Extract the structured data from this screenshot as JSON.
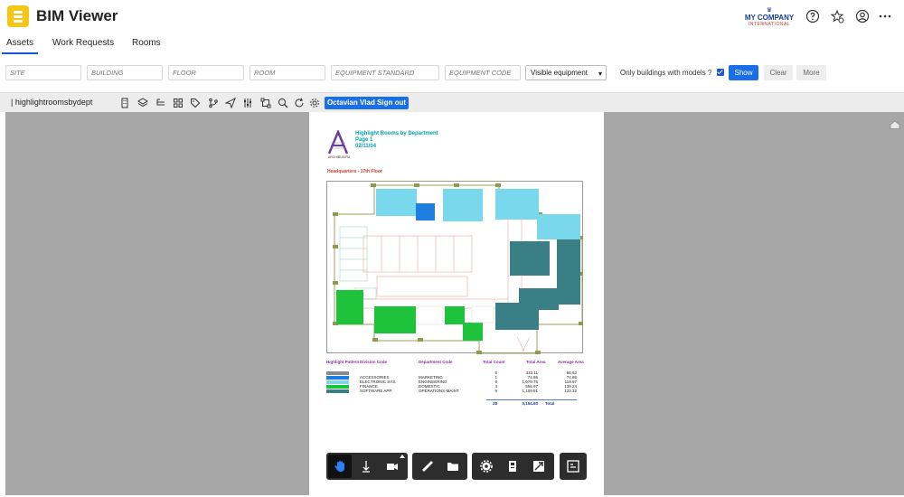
{
  "app": {
    "title": "BIM Viewer"
  },
  "brand": {
    "name": "MY COMPANY",
    "tagline": "INTERNATIONAL"
  },
  "header_icons": [
    "help-icon",
    "favorite-star-icon",
    "user-icon",
    "more-horizontal-icon"
  ],
  "tabs": [
    {
      "label": "Assets",
      "active": true
    },
    {
      "label": "Work Requests",
      "active": false
    },
    {
      "label": "Rooms",
      "active": false
    }
  ],
  "filters": {
    "site": {
      "placeholder": "SITE",
      "value": ""
    },
    "building": {
      "placeholder": "BUILDING",
      "value": ""
    },
    "floor": {
      "placeholder": "FLOOR",
      "value": ""
    },
    "room": {
      "placeholder": "ROOM",
      "value": ""
    },
    "equipment_standard": {
      "placeholder": "EQUIPMENT STANDARD",
      "value": ""
    },
    "equipment_code": {
      "placeholder": "EQUIPMENT CODE",
      "value": ""
    },
    "visibility_select": "Visible equipment",
    "only_models_label": "Only buildings with models ?",
    "only_models_checked": true,
    "show_label": "Show",
    "clear_label": "Clear",
    "more_label": "More"
  },
  "viewer_toolbar": {
    "title": "| highlightroomsbydept",
    "signout_label": "Octavian Vlad Sign out",
    "icons": [
      "building-icon",
      "layers-icon",
      "tree-list-icon",
      "grid-icon",
      "tag-icon",
      "branch-icon",
      "send-icon",
      "sliders-icon",
      "frame-icon",
      "zoom-icon",
      "refresh-icon",
      "settings-icon"
    ]
  },
  "document": {
    "logo_text": "ARCHIBUS/FM",
    "report_title": "Highlight Rooms by Department",
    "page_label": "Page 1",
    "date": "02/11/04",
    "floor_label": "Headquarters - 17th Floor",
    "legend_headers": {
      "pattern": "Highlight Pattern",
      "division": "Division Code",
      "department": "Department Code",
      "count": "Total Count",
      "area": "Total Area",
      "avg": "Average Area"
    },
    "legend_rows": [
      {
        "division": "",
        "department": "",
        "count": "5",
        "area": "333.11",
        "avg": "66.62",
        "color": "#8a8a8a"
      },
      {
        "division": "ACCESSORIES",
        "department": "MARKETING",
        "count": "1",
        "area": "74.86",
        "avg": "74.86",
        "color": "#1f7fe0"
      },
      {
        "division": "ELECTRONIC SYS.",
        "department": "ENGINEERING",
        "count": "9",
        "area": "1,079.75",
        "avg": "119.97",
        "color": "#7ad8ec"
      },
      {
        "division": "FINANCE",
        "department": "DOMESTIC",
        "count": "4",
        "area": "556.97",
        "avg": "139.24",
        "color": "#1ec23b"
      },
      {
        "division": "SOFTWARE APP.",
        "department": "OPERATIONS-MAINT",
        "count": "9",
        "area": "1,109.91",
        "avg": "123.32",
        "color": "#3a7f86"
      }
    ],
    "totals": {
      "count": "28",
      "area": "3,154.60",
      "label": "Total"
    }
  },
  "bottom_toolbar": {
    "groups": [
      [
        "pan-hand-icon",
        "dolly-icon",
        "camera-icon"
      ],
      [
        "measure-icon",
        "folder-icon"
      ],
      [
        "settings-icon",
        "model-browser-icon",
        "fullscreen-icon"
      ],
      [
        "properties-icon"
      ]
    ]
  }
}
